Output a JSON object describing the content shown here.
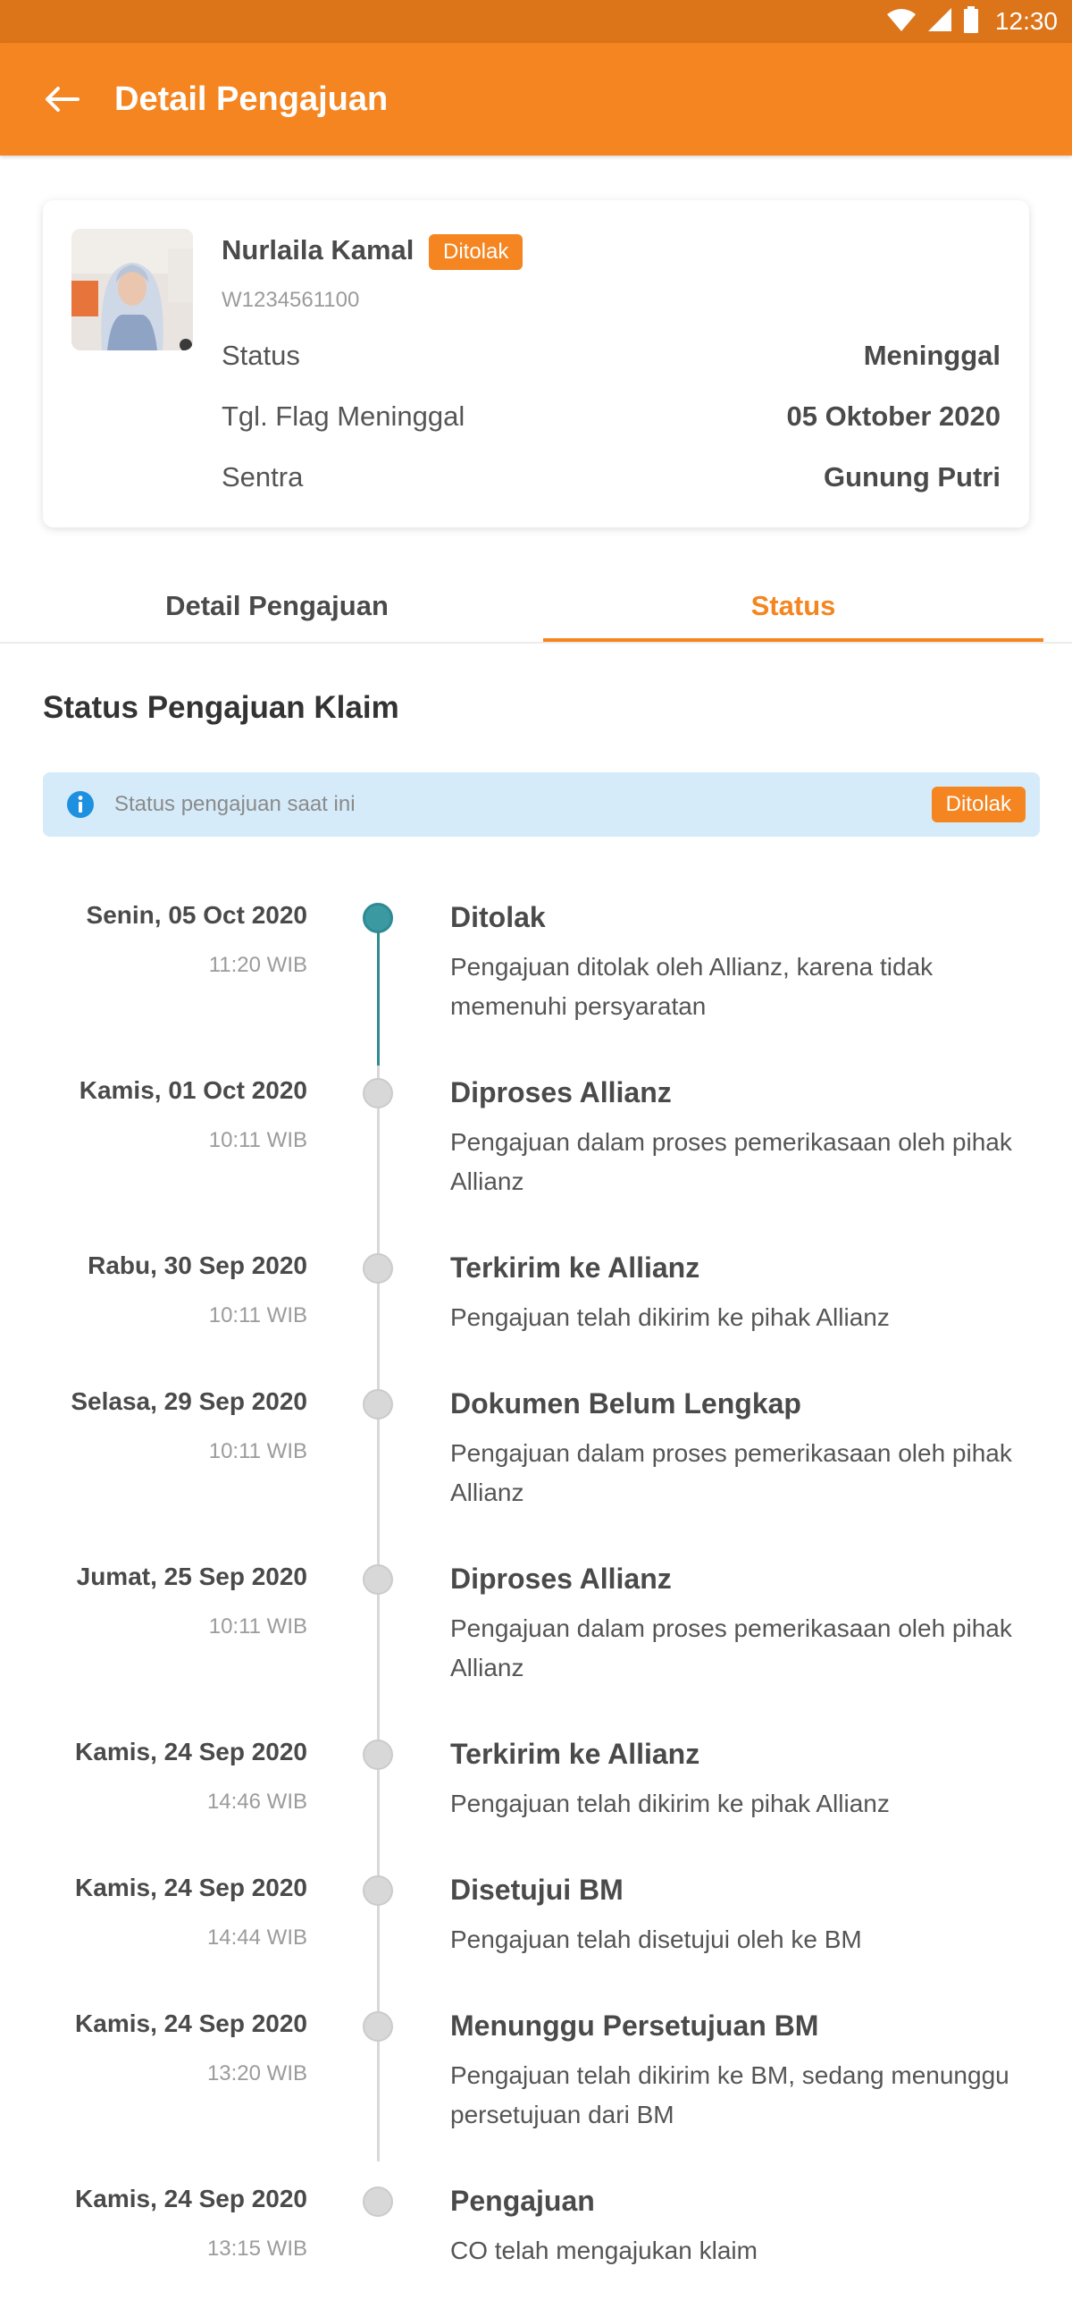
{
  "status_bar": {
    "time": "12:30"
  },
  "header": {
    "title": "Detail Pengajuan"
  },
  "profile": {
    "name": "Nurlaila Kamal",
    "badge": "Ditolak",
    "id": "W1234561100",
    "rows": [
      {
        "label": "Status",
        "value": "Meninggal"
      },
      {
        "label": "Tgl. Flag Meninggal",
        "value": "05 Oktober 2020"
      },
      {
        "label": "Sentra",
        "value": "Gunung Putri"
      }
    ]
  },
  "tabs": [
    {
      "label": "Detail Pengajuan"
    },
    {
      "label": "Status",
      "active": true
    }
  ],
  "section": {
    "title": "Status Pengajuan Klaim"
  },
  "info": {
    "text": "Status pengajuan saat ini",
    "badge": "Ditolak"
  },
  "timeline": [
    {
      "date": "Senin, 05 Oct 2020",
      "time": "11:20 WIB",
      "title": "Ditolak",
      "desc": "Pengajuan ditolak oleh Allianz, karena tidak memenuhi persyaratan",
      "active": true
    },
    {
      "date": "Kamis, 01 Oct 2020",
      "time": "10:11 WIB",
      "title": "Diproses Allianz",
      "desc": "Pengajuan dalam proses pemerikasaan oleh pihak Allianz"
    },
    {
      "date": "Rabu, 30 Sep 2020",
      "time": "10:11 WIB",
      "title": "Terkirim ke Allianz",
      "desc": "Pengajuan telah dikirim ke pihak Allianz"
    },
    {
      "date": "Selasa, 29 Sep 2020",
      "time": "10:11 WIB",
      "title": "Dokumen Belum Lengkap",
      "desc": "Pengajuan dalam proses pemerikasaan oleh pihak Allianz"
    },
    {
      "date": "Jumat, 25 Sep 2020",
      "time": "10:11 WIB",
      "title": "Diproses Allianz",
      "desc": "Pengajuan dalam proses pemerikasaan oleh pihak Allianz"
    },
    {
      "date": "Kamis, 24 Sep 2020",
      "time": "14:46 WIB",
      "title": "Terkirim ke Allianz",
      "desc": "Pengajuan telah dikirim ke pihak Allianz"
    },
    {
      "date": "Kamis, 24 Sep 2020",
      "time": "14:44 WIB",
      "title": "Disetujui BM",
      "desc": "Pengajuan telah disetujui oleh ke BM"
    },
    {
      "date": "Kamis, 24 Sep 2020",
      "time": "13:20 WIB",
      "title": "Menunggu Persetujuan BM",
      "desc": "Pengajuan telah dikirim ke BM, sedang menunggu persetujuan dari BM"
    },
    {
      "date": "Kamis, 24 Sep 2020",
      "time": "13:15 WIB",
      "title": "Pengajuan",
      "desc": "CO telah mengajukan klaim"
    }
  ],
  "colors": {
    "primary": "#f48520",
    "status_bar": "#dc7419",
    "active_dot": "#3b9aa1",
    "info_bg": "#d5ebf9"
  }
}
